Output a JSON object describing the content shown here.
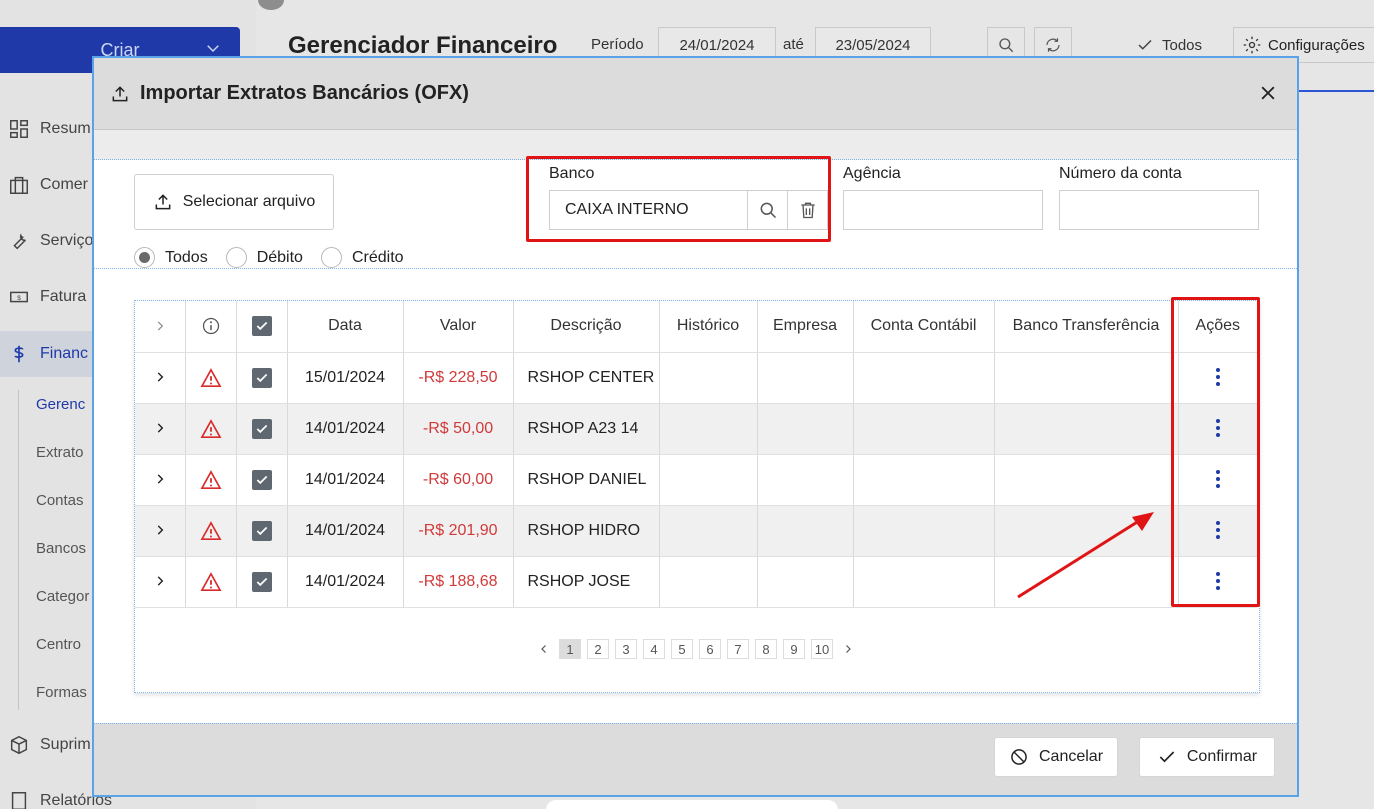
{
  "sidebar": {
    "create_label": "Criar",
    "items": [
      {
        "label": "Resum",
        "icon": "dashboard-icon"
      },
      {
        "label": "Comer",
        "icon": "store-icon"
      },
      {
        "label": "Serviço",
        "icon": "wrench-icon"
      },
      {
        "label": "Fatura",
        "icon": "bill-icon"
      },
      {
        "label": "Financ",
        "icon": "dollar-icon"
      },
      {
        "label": "Suprim",
        "icon": "box-icon"
      },
      {
        "label": "Relatórios",
        "icon": "report-icon"
      }
    ],
    "subitems": [
      "Gerenc",
      "Extrato",
      "Contas",
      "Bancos",
      "Categor",
      "Centro",
      "Formas"
    ]
  },
  "header": {
    "title": "Gerenciador Financeiro",
    "period_label": "Período",
    "date_from": "24/01/2024",
    "until_label": "até",
    "date_to": "23/05/2024",
    "all_label": "Todos",
    "settings_label": "Configurações"
  },
  "modal": {
    "title": "Importar Extratos Bancários (OFX)",
    "select_file_label": "Selecionar arquivo",
    "filters": [
      "Todos",
      "Débito",
      "Crédito"
    ],
    "selected_filter": "Todos",
    "bank_label": "Banco",
    "bank_value": "CAIXA INTERNO",
    "agency_label": "Agência",
    "agency_value": "",
    "account_label": "Número da conta",
    "account_value": "",
    "table": {
      "columns": [
        "Data",
        "Valor",
        "Descrição",
        "Histórico",
        "Empresa",
        "Conta Contábil",
        "Banco Transferência",
        "Ações"
      ],
      "rows": [
        {
          "date": "15/01/2024",
          "value": "-R$ 228,50",
          "description": "RSHOP CENTER",
          "history": "",
          "company": "",
          "account": "",
          "transfer_bank": ""
        },
        {
          "date": "14/01/2024",
          "value": "-R$ 50,00",
          "description": "RSHOP A23 14",
          "history": "",
          "company": "",
          "account": "",
          "transfer_bank": ""
        },
        {
          "date": "14/01/2024",
          "value": "-R$ 60,00",
          "description": "RSHOP DANIEL",
          "history": "",
          "company": "",
          "account": "",
          "transfer_bank": ""
        },
        {
          "date": "14/01/2024",
          "value": "-R$ 201,90",
          "description": "RSHOP HIDRO",
          "history": "",
          "company": "",
          "account": "",
          "transfer_bank": ""
        },
        {
          "date": "14/01/2024",
          "value": "-R$ 188,68",
          "description": "RSHOP JOSE",
          "history": "",
          "company": "",
          "account": "",
          "transfer_bank": ""
        }
      ]
    },
    "pagination": {
      "pages": [
        "1",
        "2",
        "3",
        "4",
        "5",
        "6",
        "7",
        "8",
        "9",
        "10"
      ],
      "current": "1"
    },
    "cancel_label": "Cancelar",
    "confirm_label": "Confirmar"
  },
  "colors": {
    "accent": "#1f3aa8",
    "negative": "#d13a3a",
    "highlight": "#e01414",
    "warning": "#d92b2b"
  }
}
